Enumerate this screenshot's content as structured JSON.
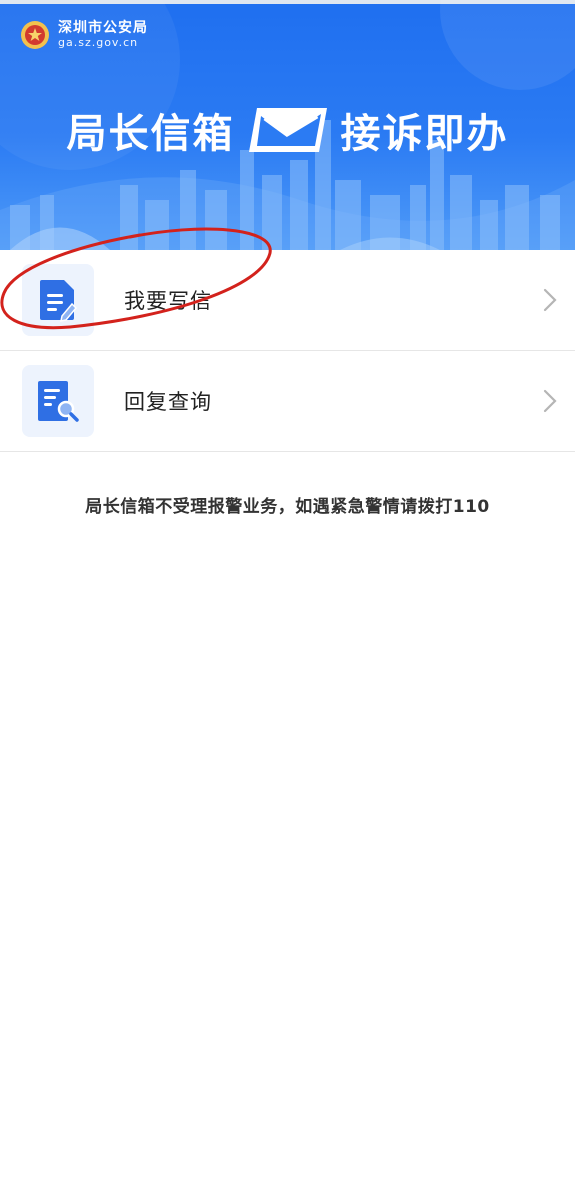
{
  "header": {
    "org_name": "深圳市公安局",
    "org_url": "ga.sz.gov.cn",
    "title_left": "局长信箱",
    "title_right": "接诉即办"
  },
  "menu": {
    "items": [
      {
        "label": "我要写信",
        "icon": "write-letter-icon"
      },
      {
        "label": "回复查询",
        "icon": "search-reply-icon"
      }
    ]
  },
  "notice": "局长信箱不受理报警业务，如遇紧急警情请拨打110",
  "colors": {
    "banner": "#2b7bf3",
    "accent": "#2f6fe4",
    "icon_bg": "#edf3fd",
    "annotation": "#d3221c"
  }
}
